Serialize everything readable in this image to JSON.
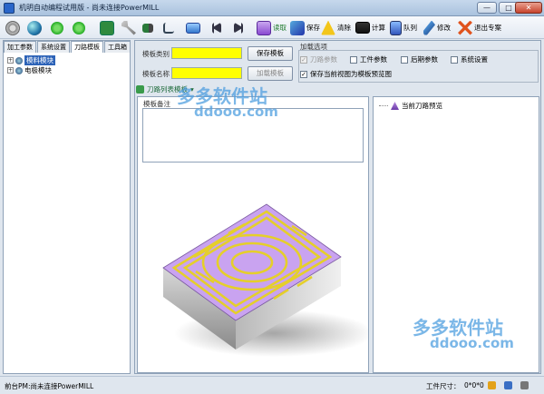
{
  "window": {
    "title": "机明自动编程试用版 - 尚未连接PowerMILL",
    "min": "—",
    "max": "□",
    "close": "✕"
  },
  "toolbar": {
    "read": "读取",
    "save": "保存",
    "clear": "清除",
    "calc": "计算",
    "queue": "队列",
    "edit": "修改",
    "exit": "退出专案"
  },
  "left": {
    "tabs": [
      "加工参数",
      "系统设置",
      "刀路模板",
      "工具箱"
    ],
    "tree": [
      "模料模块",
      "电极模块"
    ]
  },
  "form": {
    "template_category_label": "模板类别",
    "template_name_label": "模板名称",
    "save_template": "保存模板",
    "load_template": "加载模板",
    "load_options_label": "加载选项",
    "opt_toolpath_params": "刀路参数",
    "opt_work_params": "工件参数",
    "opt_post_params": "后期参数",
    "opt_system_settings": "系统设置",
    "opt_save_view": "保存当前视图为模板预览图"
  },
  "path": {
    "label": "刀路列表模板"
  },
  "note": {
    "label": "模板备注"
  },
  "preview": {
    "label": "当前刀路预览"
  },
  "status": {
    "left": "前台PM:尚未连接PowerMILL",
    "size_label": "工件尺寸：",
    "size_value": "0*0*0"
  },
  "watermark": {
    "brand": "多多软件站",
    "url": "ddooo.com"
  },
  "colors": {
    "accent": "#2d63b8",
    "highlight_input": "#ffff00",
    "part_top": "#c9a3f0",
    "toolpath": "#e5cf2a"
  }
}
